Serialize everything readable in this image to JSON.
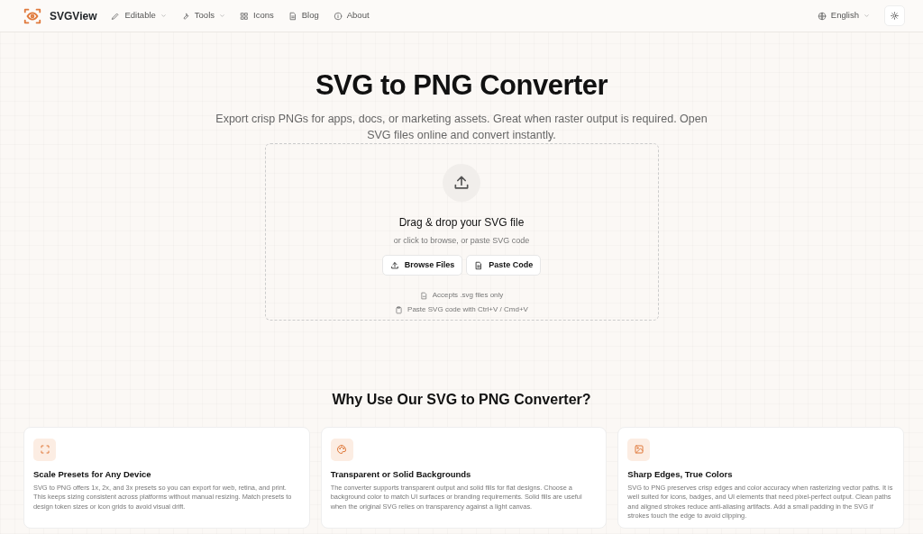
{
  "brand": "SVGView",
  "nav": [
    {
      "label": "Editable",
      "dropdown": true
    },
    {
      "label": "Tools",
      "dropdown": true
    },
    {
      "label": "Icons",
      "dropdown": false
    },
    {
      "label": "Blog",
      "dropdown": false
    },
    {
      "label": "About",
      "dropdown": false
    }
  ],
  "language": {
    "label": "English",
    "dropdown": true
  },
  "hero": {
    "title": "SVG to PNG Converter",
    "subtitle": "Export crisp PNGs for apps, docs, or marketing assets. Great when raster output is required. Open SVG files online and convert instantly."
  },
  "dropzone": {
    "title": "Drag & drop your SVG file",
    "subtitle": "or click to browse, or paste SVG code",
    "buttons": [
      "Browse Files",
      "Paste Code"
    ],
    "hints": [
      "Accepts .svg files only",
      "Paste SVG code with Ctrl+V / Cmd+V"
    ]
  },
  "features": {
    "heading": "Why Use Our SVG to PNG Converter?",
    "cards": [
      {
        "title": "Scale Presets for Any Device",
        "text": "SVG to PNG offers 1x, 2x, and 3x presets so you can export for web, retina, and print. This keeps sizing consistent across platforms without manual resizing. Match presets to design token sizes or icon grids to avoid visual drift."
      },
      {
        "title": "Transparent or Solid Backgrounds",
        "text": "The converter supports transparent output and solid fills for flat designs. Choose a background color to match UI surfaces or branding requirements. Solid fills are useful when the original SVG relies on transparency against a light canvas."
      },
      {
        "title": "Sharp Edges, True Colors",
        "text": "SVG to PNG preserves crisp edges and color accuracy when rasterizing vector paths. It is well suited for icons, badges, and UI elements that need pixel-perfect output. Clean paths and aligned strokes reduce anti-aliasing artifacts. Add a small padding in the SVG if strokes touch the edge to avoid clipping."
      }
    ]
  }
}
